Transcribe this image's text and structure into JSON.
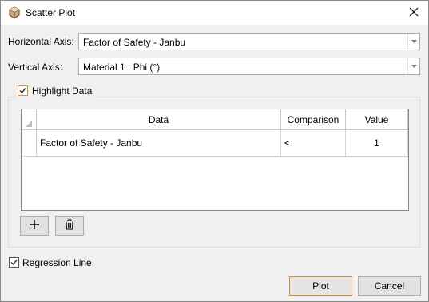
{
  "window": {
    "title": "Scatter Plot",
    "app_icon": "cube-icon",
    "close_icon": "close-icon"
  },
  "axes": {
    "horizontal_label": "Horizontal Axis:",
    "horizontal_value": "Factor of Safety - Janbu",
    "vertical_label": "Vertical Axis:",
    "vertical_value": "Material 1 : Phi (°)"
  },
  "highlight": {
    "label": "Highlight Data",
    "checked": true,
    "table": {
      "columns": [
        "Data",
        "Comparison",
        "Value"
      ],
      "rows": [
        {
          "data": "Factor of Safety - Janbu",
          "comparison": "<",
          "value": "1"
        }
      ]
    },
    "add_icon": "plus-icon",
    "delete_icon": "trash-icon"
  },
  "regression": {
    "label": "Regression Line",
    "checked": true
  },
  "buttons": {
    "plot": "Plot",
    "cancel": "Cancel"
  },
  "colors": {
    "accent": "#d08c3c",
    "titlebar": "#ffffff",
    "dialog": "#f0f0f0"
  }
}
